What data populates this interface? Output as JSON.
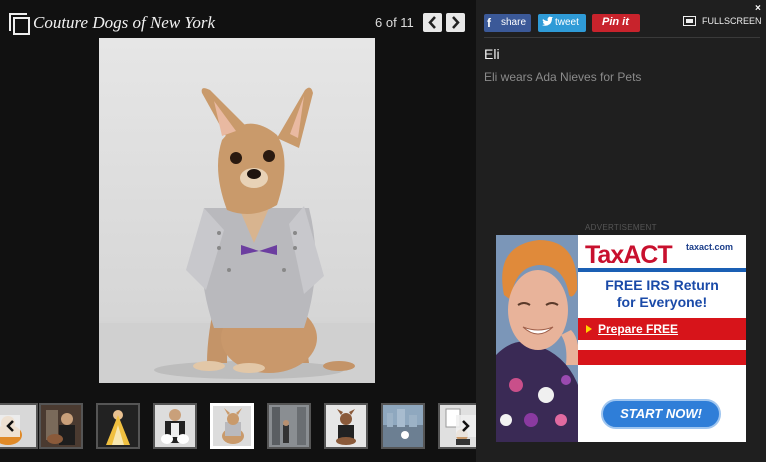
{
  "gallery": {
    "title": "Couture Dogs of New York",
    "counter": "6 of 11"
  },
  "photo": {
    "subject": "Chihuahua in silver studded vest"
  },
  "share": {
    "facebook_label": "share",
    "twitter_label": "tweet",
    "pinterest_label": "Pin it",
    "fullscreen_label": "FULLSCREEN",
    "close_glyph": "×"
  },
  "caption": {
    "title": "Eli",
    "text": "Eli wears Ada Nieves for Pets"
  },
  "ad": {
    "label": "ADVERTISEMENT",
    "brand": "TaxACT",
    "url": "taxact.com",
    "headline_line1": "FREE IRS Return",
    "headline_line2": "for Everyone!",
    "cta_link": "Prepare FREE",
    "cta_button": "START NOW!"
  },
  "thumbnails": {
    "active_index": 4,
    "count": 9
  },
  "colors": {
    "facebook": "#3b5998",
    "twitter": "#2f9bd7",
    "pinterest": "#c8232c",
    "ad_red": "#d7141a",
    "ad_blue": "#1a4aa8"
  }
}
